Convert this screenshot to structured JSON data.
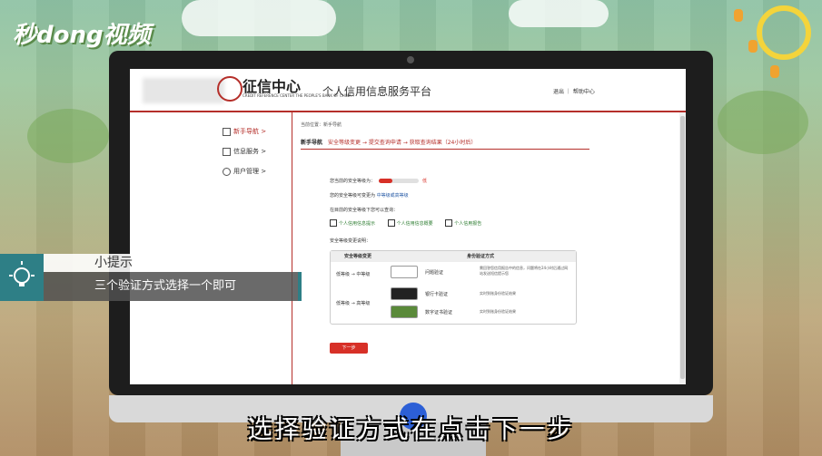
{
  "watermark": {
    "logo": "秒dong视频"
  },
  "portal": {
    "brand_cn": "征信中心",
    "brand_en": "CREDIT REFERENCE CENTER THE PEOPLE'S BANK OF CHINA",
    "title": "个人信用信息服务平台",
    "top_links": "退出 ｜ 帮助中心"
  },
  "sidebar": {
    "items": [
      {
        "label": "新手导航 >",
        "icon": "book-icon"
      },
      {
        "label": "信息服务 >",
        "icon": "document-icon"
      },
      {
        "label": "用户管理 >",
        "icon": "user-icon"
      }
    ]
  },
  "main": {
    "breadcrumb": "当前位置：新手导航",
    "section_title": "新手导航",
    "steps": "安全等级变更 → 提交查询申请 → 获取查询结果（24小时后）",
    "security_label": "您当前的安全等级为：",
    "security_level": "低",
    "security_fill": 0.35,
    "upgrade_label": "您的安全等级可变更为",
    "upgrade_value": "中等级或高等级",
    "query_label": "在目前的安全等级下您可以查询：",
    "links": [
      "个人信用信息提示",
      "个人信用信息概要",
      "个人信用报告"
    ],
    "change_note": "安全等级变更说明：",
    "table_headers": [
      "安全等级变更",
      "身份验证方式"
    ],
    "rows": [
      {
        "level": "低等级 → 中等级",
        "method": "问题验证",
        "desc": "需回答您信用报告中的信息，问题将在24小时后通过网站发送短信提示您"
      },
      {
        "level": "低等级 → 高等级",
        "method": "银行卡验证",
        "desc": "实时到账身份验证结果"
      },
      {
        "level": "",
        "method": "数字证书验证",
        "desc": "实时到账身份验证结果"
      }
    ],
    "next_button": "下一步"
  },
  "tip": {
    "title": "小提示",
    "text": "三个验证方式选择一个即可"
  },
  "subtitle": "选择验证方式在点击下一步"
}
